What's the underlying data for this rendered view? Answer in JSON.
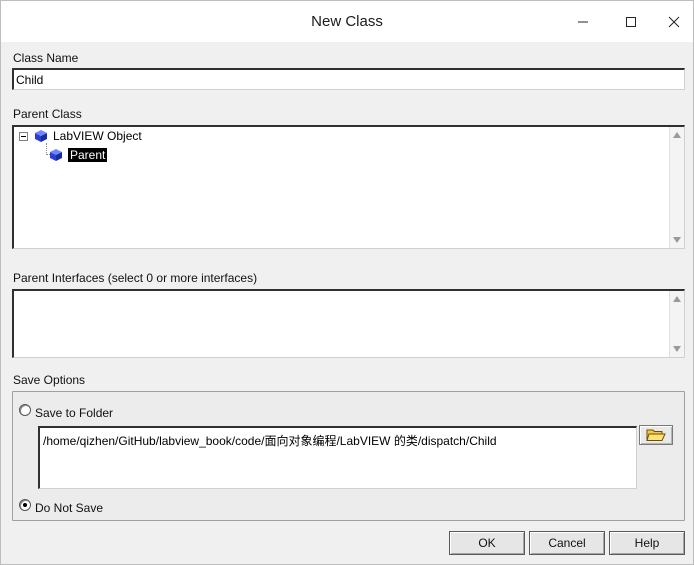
{
  "window": {
    "title": "New Class",
    "controls": {
      "minimize_icon": "minimize-icon",
      "maximize_icon": "maximize-icon",
      "close_icon": "close-icon"
    }
  },
  "class_name": {
    "label": "Class Name",
    "value": "Child"
  },
  "parent_class": {
    "label": "Parent Class",
    "tree": [
      {
        "label": "LabVIEW Object",
        "icon": "cube-icon",
        "expanded": true,
        "selected": false
      },
      {
        "label": "Parent",
        "icon": "cube-icon",
        "selected": true
      }
    ]
  },
  "parent_interfaces": {
    "label": "Parent Interfaces (select 0 or more interfaces)",
    "items": []
  },
  "save_options": {
    "label": "Save Options",
    "save_to_folder_label": "Save to Folder",
    "folder_path": "/home/qizhen/GitHub/labview_book/code/面向对象编程/LabVIEW 的类/dispatch/Child",
    "browse_icon": "folder-open-icon",
    "do_not_save_label": "Do Not Save",
    "selected": "Do Not Save"
  },
  "buttons": {
    "ok": "OK",
    "cancel": "Cancel",
    "help": "Help"
  },
  "colors": {
    "window_bg": "#f0f0f0",
    "cube_blue": "#2b3fd6",
    "selection_bg": "#000000"
  }
}
